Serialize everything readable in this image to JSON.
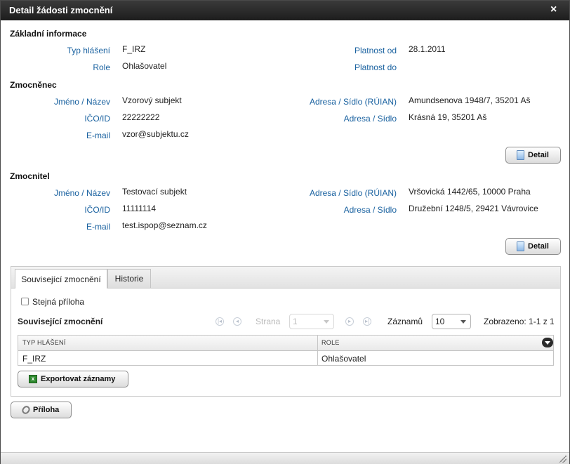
{
  "dialog": {
    "title": "Detail žádosti zmocnění",
    "close": "×"
  },
  "basic": {
    "title": "Základní informace",
    "typ_label": "Typ hlášení",
    "typ_value": "F_IRZ",
    "role_label": "Role",
    "role_value": "Ohlašovatel",
    "platnost_od_label": "Platnost od",
    "platnost_od_value": "28.1.2011",
    "platnost_do_label": "Platnost do",
    "platnost_do_value": ""
  },
  "zmocnenec": {
    "title": "Zmocněnec",
    "jmeno_label": "Jméno / Název",
    "jmeno_value": "Vzorový subjekt",
    "ico_label": "IČO/ID",
    "ico_value": "22222222",
    "email_label": "E-mail",
    "email_value": "vzor@subjektu.cz",
    "adresa_ruian_label": "Adresa / Sídlo (RÚIAN)",
    "adresa_ruian_value": "Amundsenova 1948/7, 35201 Aš",
    "adresa_label": "Adresa / Sídlo",
    "adresa_value": "Krásná 19, 35201 Aš",
    "detail_button": "Detail"
  },
  "zmocnitel": {
    "title": "Zmocnitel",
    "jmeno_label": "Jméno / Název",
    "jmeno_value": "Testovací subjekt",
    "ico_label": "IČO/ID",
    "ico_value": "11111114",
    "email_label": "E-mail",
    "email_value": "test.ispop@seznam.cz",
    "adresa_ruian_label": "Adresa / Sídlo (RÚIAN)",
    "adresa_ruian_value": "Vršovická 1442/65, 10000 Praha",
    "adresa_label": "Adresa / Sídlo",
    "adresa_value": "Družební 1248/5, 29421 Vávrovice",
    "detail_button": "Detail"
  },
  "tabs": [
    {
      "label": "Související zmocnění"
    },
    {
      "label": "Historie"
    }
  ],
  "related": {
    "checkbox_label": "Stejná příloha",
    "title": "Související zmocnění",
    "pager": {
      "page_label": "Strana",
      "page_value": "1",
      "records_label": "Záznamů",
      "records_value": "10",
      "shown": "Zobrazeno: 1-1 z 1"
    },
    "columns": [
      "TYP HLÁŠENÍ",
      "ROLE"
    ],
    "rows": [
      [
        "F_IRZ",
        "Ohlašovatel"
      ]
    ],
    "export_button": "Exportovat záznamy"
  },
  "attachment_button": "Příloha"
}
